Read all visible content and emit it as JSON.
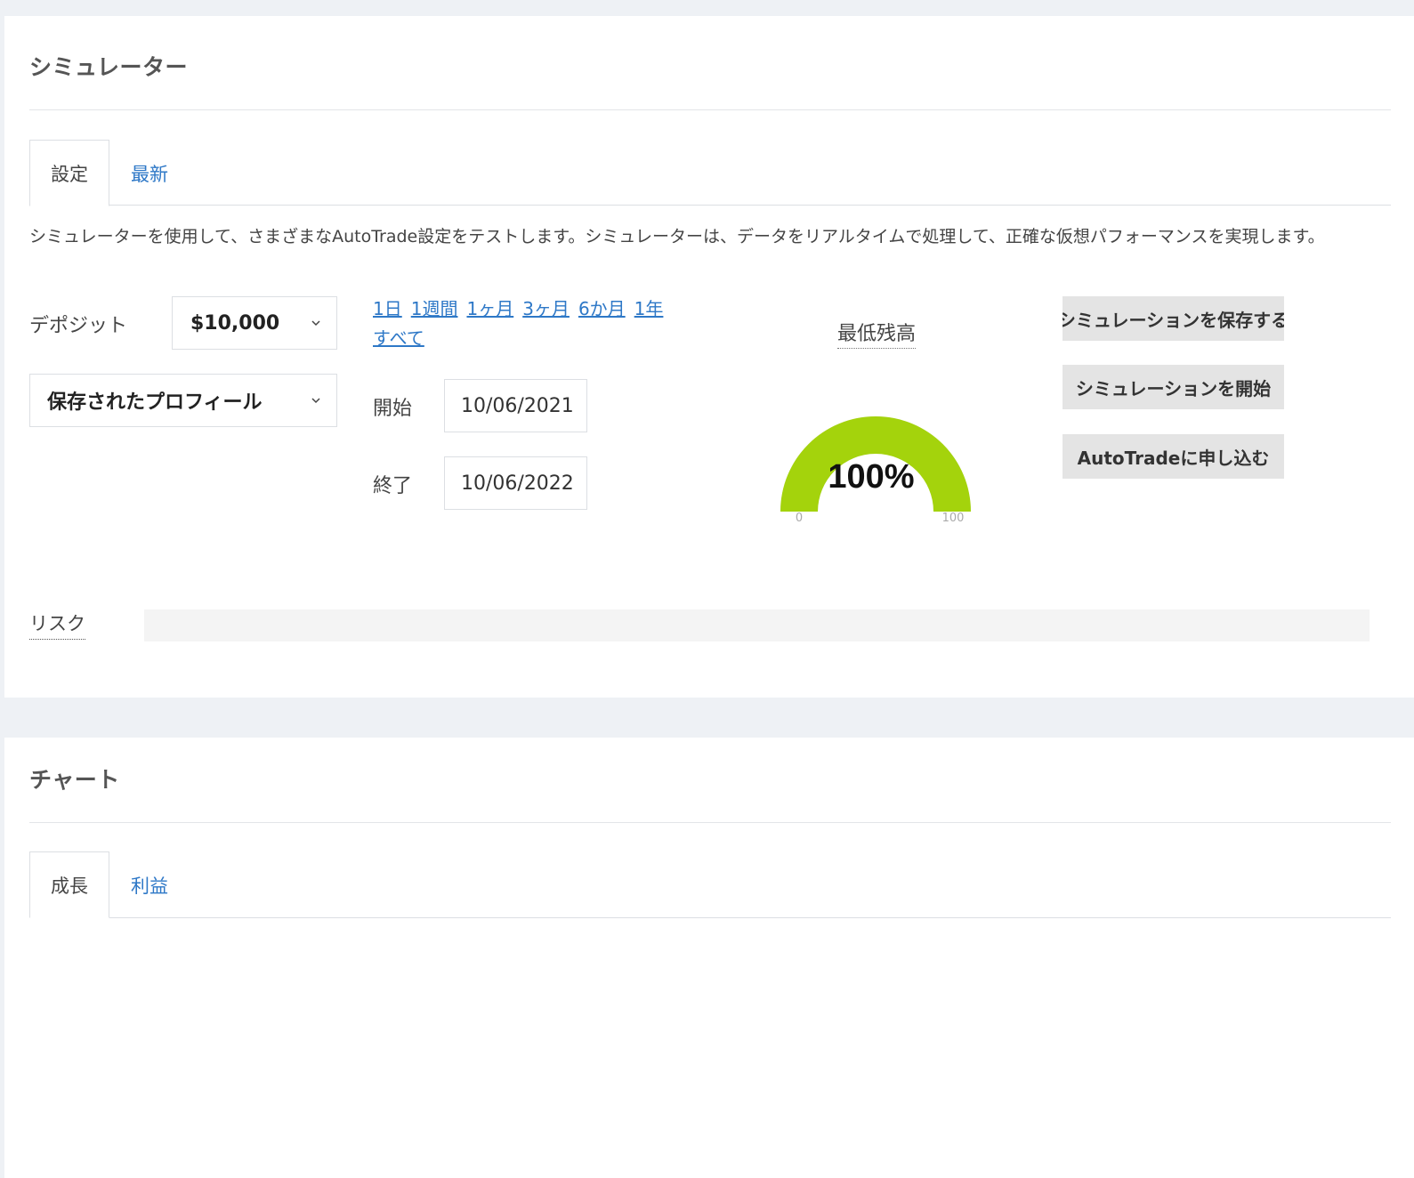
{
  "simulator": {
    "title": "シミュレーター",
    "tabs": [
      {
        "label": "設定",
        "active": true
      },
      {
        "label": "最新",
        "active": false
      }
    ],
    "description": "シミュレーターを使用して、さまざまなAutoTrade設定をテストします。シミュレーターは、データをリアルタイムで処理して、正確な仮想パフォーマンスを実現します。",
    "deposit_label": "デポジット",
    "deposit_value": "$10,000",
    "saved_profile": "保存されたプロフィール",
    "ranges": [
      "1日",
      "1週間",
      "1ヶ月",
      "3ヶ月",
      "6か月",
      "1年",
      "すべて"
    ],
    "start_label": "開始",
    "start_value": "10/06/2021",
    "end_label": "終了",
    "end_value": "10/06/2022",
    "gauge": {
      "title": "最低残高",
      "value_text": "100%",
      "value_fraction": 1.0,
      "min_label": "0",
      "max_label": "100",
      "color": "#a4d30c"
    },
    "buttons": {
      "save": "シミュレーションを保存する",
      "start": "シミュレーションを開始",
      "apply": "AutoTradeに申し込む"
    },
    "risk_label": "リスク"
  },
  "chart_section": {
    "title": "チャート",
    "tabs": [
      {
        "label": "成長",
        "active": true
      },
      {
        "label": "利益",
        "active": false
      }
    ]
  },
  "colors": {
    "link": "#2e78c7",
    "page_bg": "#eef1f5",
    "button_bg": "#e4e4e4"
  }
}
